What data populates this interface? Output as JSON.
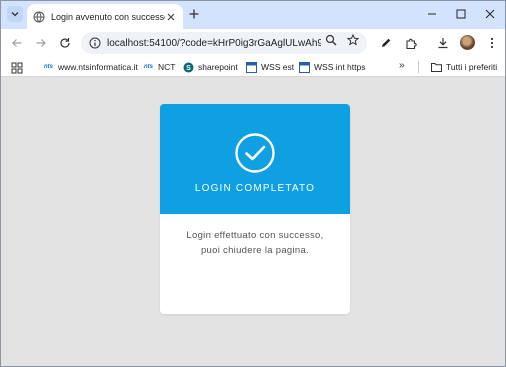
{
  "browser": {
    "tab": {
      "title": "Login avvenuto con successo"
    },
    "address_bar": {
      "url": "localhost:54100/?code=kHrP0ig3rGaAglULwAh9ZX..."
    },
    "bookmarks": [
      {
        "label": "www.ntsinformatica.it",
        "icon": "nts-icon"
      },
      {
        "label": "NCT",
        "icon": "nts-icon"
      },
      {
        "label": "sharepoint",
        "icon": "sharepoint-icon"
      },
      {
        "label": "WSS est",
        "icon": "wss-icon"
      },
      {
        "label": "WSS int https",
        "icon": "wss-icon"
      }
    ],
    "bookmarks_more": "»",
    "other_bookmarks": "Tutti i preferiti"
  },
  "page": {
    "title": "LOGIN COMPLETATO",
    "message_line1": "Login effettuato con successo,",
    "message_line2": "puoi chiudere la pagina."
  },
  "colors": {
    "accent": "#0ea0e1",
    "tabstrip": "#d3e3fd",
    "page_bg": "#e3e3e3"
  }
}
